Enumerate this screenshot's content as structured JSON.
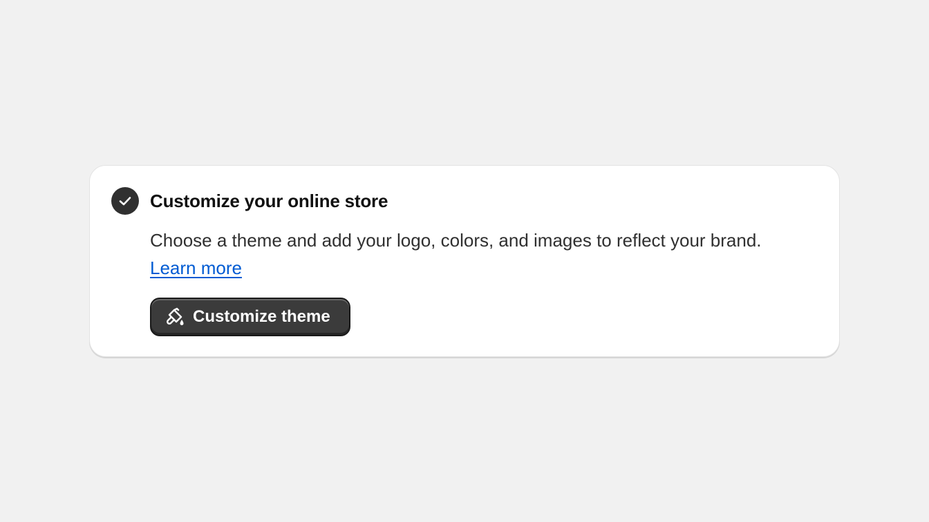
{
  "task_card": {
    "title": "Customize your online store",
    "description": "Choose a theme and add your logo, colors, and images to reflect your brand.",
    "link_label": "Learn more",
    "button_label": "Customize theme",
    "status_icon": "check-circle-icon",
    "button_icon": "paint-brush-icon",
    "colors": {
      "link": "#005bd3",
      "button_bg": "#3b3b3b",
      "check_bg": "#303030"
    }
  }
}
